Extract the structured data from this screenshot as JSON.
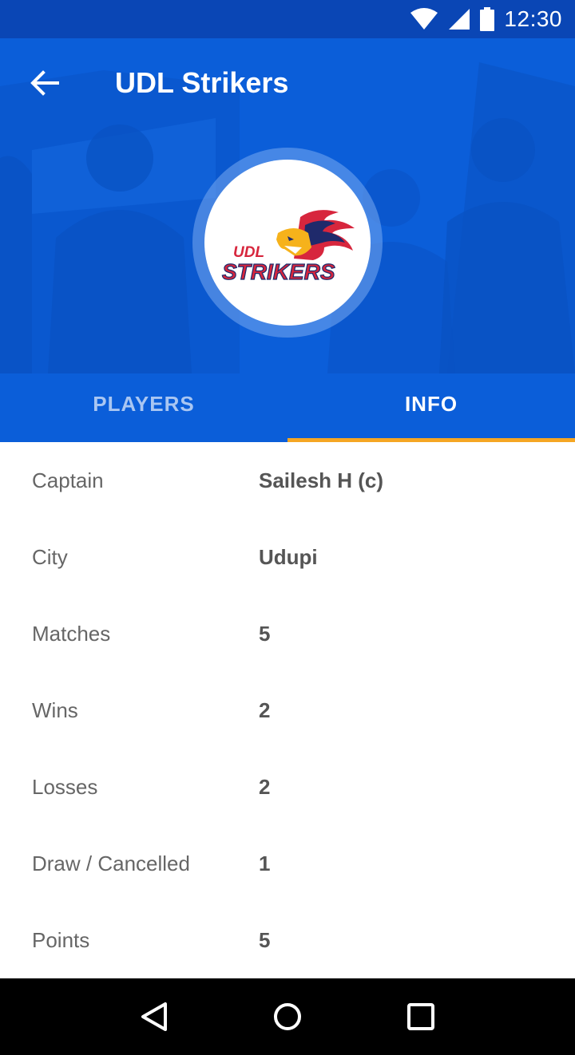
{
  "status_bar": {
    "time": "12:30",
    "icons": [
      "wifi-icon",
      "signal-icon",
      "battery-icon"
    ]
  },
  "header": {
    "title": "UDL Strikers",
    "back_icon": "arrow-left-icon",
    "logo": {
      "line1": "UDL",
      "line2": "STRIKERS"
    }
  },
  "tabs": [
    {
      "label": "PLAYERS",
      "active": false
    },
    {
      "label": "INFO",
      "active": true
    }
  ],
  "info": [
    {
      "label": "Captain",
      "value": "Sailesh H (c)"
    },
    {
      "label": "City",
      "value": "Udupi"
    },
    {
      "label": "Matches",
      "value": "5"
    },
    {
      "label": "Wins",
      "value": "2"
    },
    {
      "label": "Losses",
      "value": "2"
    },
    {
      "label": "Draw / Cancelled",
      "value": "1"
    },
    {
      "label": "Points",
      "value": "5"
    }
  ],
  "nav": [
    "back-triangle-icon",
    "home-circle-icon",
    "recents-square-icon"
  ],
  "colors": {
    "status_bar": "#0a46b5",
    "header": "#0b5ed9",
    "tab_indicator": "#f5a623",
    "nav_bar": "#000000"
  }
}
